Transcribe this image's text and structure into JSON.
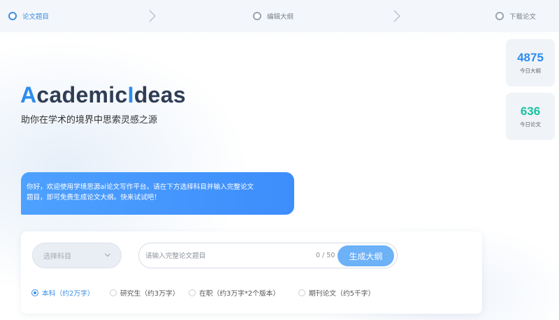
{
  "steps": [
    {
      "label": "论文题目",
      "active": true
    },
    {
      "label": "编辑大纲",
      "active": false
    },
    {
      "label": "下载论文",
      "active": false
    }
  ],
  "stats": {
    "outlines": {
      "value": "4875",
      "label": "今日大纲",
      "color": "#2d8cf0"
    },
    "papers": {
      "value": "636",
      "label": "今日论文",
      "color": "#19c3a0"
    }
  },
  "hero": {
    "title_a": "A",
    "title_rest1": "cademic",
    "title_i": "I",
    "title_rest2": "deas",
    "subtitle": "助你在学术的境界中思索灵感之源"
  },
  "welcome": {
    "line1": "你好，欢迎使用学境思源ai论文写作平台。请在下方选择科目并输入完整论文",
    "line2": "题目，即可免费生成论文大纲。快来试试吧！"
  },
  "form": {
    "subject_placeholder": "选择科目",
    "topic_placeholder": "请输入完整论文题目",
    "char_count": "0 / 50",
    "generate_label": "生成大纲",
    "options": [
      {
        "label": "本科（约2万字）",
        "checked": true
      },
      {
        "label": "研究生（约3万字）",
        "checked": false
      },
      {
        "label": "在职（约3万字*2个版本）",
        "checked": false
      },
      {
        "label": "期刊论文（约5千字）",
        "checked": false
      }
    ]
  },
  "colors": {
    "accent": "#2d8cf0",
    "teal": "#19c3a0",
    "button": "#6db1f7"
  }
}
